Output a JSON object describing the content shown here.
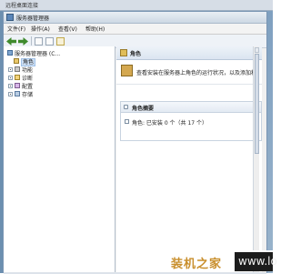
{
  "outer_window": {
    "title": "远程桌面连接"
  },
  "window": {
    "title": "服务器管理器"
  },
  "menu": [
    {
      "label": "文件(F)"
    },
    {
      "label": "操作(A)"
    },
    {
      "label": "查看(V)"
    },
    {
      "label": "帮助(H)"
    }
  ],
  "toolbar": {
    "icons": [
      "back-icon",
      "forward-icon",
      "up-icon",
      "properties-icon",
      "help-icon"
    ]
  },
  "tree": {
    "items": [
      {
        "label": "服务器管理器 (C...",
        "icon": "server-icon",
        "expander": false
      },
      {
        "label": "角色",
        "icon": "roles-icon",
        "expander": false,
        "selected": true
      },
      {
        "label": "功能",
        "icon": "features-icon",
        "expander": true
      },
      {
        "label": "诊断",
        "icon": "diagnostics-icon",
        "expander": true
      },
      {
        "label": "配置",
        "icon": "configuration-icon",
        "expander": true
      },
      {
        "label": "存储",
        "icon": "storage-icon",
        "expander": true
      }
    ]
  },
  "content": {
    "header": "角色",
    "intro": "查看安装在服务器上角色的运行状况，以及添加和",
    "section_title": "角色摘要",
    "roles_line": "角色: 已安装 0 个（共 17 个）"
  },
  "watermark": {
    "text_cn": "装机之家",
    "text_en": "www.lo"
  },
  "colors": {
    "accent": "#3f8a2c",
    "watermark_text": "#c98f2d"
  }
}
